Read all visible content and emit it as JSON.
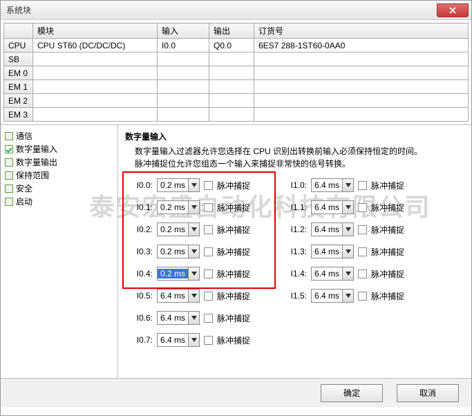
{
  "window": {
    "title": "系统块"
  },
  "grid": {
    "headers": {
      "module": "模块",
      "input": "输入",
      "output": "输出",
      "order": "订货号"
    },
    "rows": [
      {
        "slot": "CPU",
        "module": "CPU ST60 (DC/DC/DC)",
        "input": "I0.0",
        "output": "Q0.0",
        "order": "6ES7 288-1ST60-0AA0"
      },
      {
        "slot": "SB",
        "module": "",
        "input": "",
        "output": "",
        "order": ""
      },
      {
        "slot": "EM 0",
        "module": "",
        "input": "",
        "output": "",
        "order": ""
      },
      {
        "slot": "EM 1",
        "module": "",
        "input": "",
        "output": "",
        "order": ""
      },
      {
        "slot": "EM 2",
        "module": "",
        "input": "",
        "output": "",
        "order": ""
      },
      {
        "slot": "EM 3",
        "module": "",
        "input": "",
        "output": "",
        "order": ""
      }
    ]
  },
  "sidebar": {
    "items": [
      {
        "label": "通信",
        "checked": false
      },
      {
        "label": "数字量输入",
        "checked": true
      },
      {
        "label": "数字量输出",
        "checked": false
      },
      {
        "label": "保持范围",
        "checked": false
      },
      {
        "label": "安全",
        "checked": false
      },
      {
        "label": "启动",
        "checked": false
      }
    ]
  },
  "content": {
    "heading": "数字量输入",
    "desc1": "数字量输入过滤器允许您选择在 CPU 识别出转换前输入必须保持恒定的时间。",
    "desc2": "脉冲捕捉位允许您组态一个输入来捕捉非常快的信号转换。",
    "pulse_label": "脉冲捕捉",
    "left": [
      {
        "label": "I0.0:",
        "value": "0.2 ms",
        "selected": false
      },
      {
        "label": "I0.1:",
        "value": "0.2 ms",
        "selected": false
      },
      {
        "label": "I0.2:",
        "value": "0.2 ms",
        "selected": false
      },
      {
        "label": "I0.3:",
        "value": "0.2 ms",
        "selected": false
      },
      {
        "label": "I0.4:",
        "value": "0.2 ms",
        "selected": true
      },
      {
        "label": "I0.5:",
        "value": "6.4 ms",
        "selected": false
      },
      {
        "label": "I0.6:",
        "value": "6.4 ms",
        "selected": false
      },
      {
        "label": "I0.7:",
        "value": "6.4 ms",
        "selected": false
      }
    ],
    "right": [
      {
        "label": "I1.0:",
        "value": "6.4 ms",
        "selected": false
      },
      {
        "label": "I1.1:",
        "value": "6.4 ms",
        "selected": false
      },
      {
        "label": "I1.2:",
        "value": "6.4 ms",
        "selected": false
      },
      {
        "label": "I1.3:",
        "value": "6.4 ms",
        "selected": false
      },
      {
        "label": "I1.4:",
        "value": "6.4 ms",
        "selected": false
      },
      {
        "label": "I1.5:",
        "value": "6.4 ms",
        "selected": false
      }
    ]
  },
  "watermark": "泰安宏盛自动化科技有限公司",
  "buttons": {
    "ok": "确定",
    "cancel": "取消"
  }
}
